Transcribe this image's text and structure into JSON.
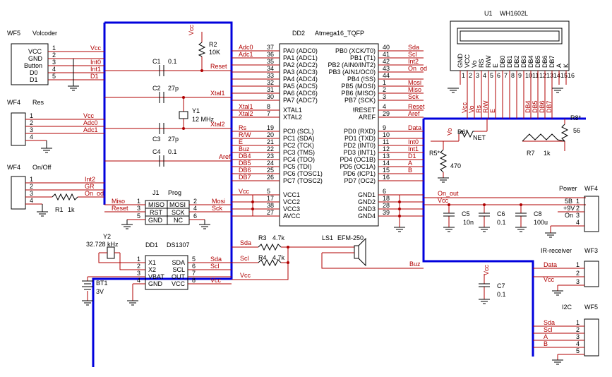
{
  "colors": {
    "wire": "#b00000",
    "bus": "#0000dd",
    "outline": "#000000"
  },
  "connectors": [
    {
      "id": "WF5",
      "name": "Volcoder",
      "pins": [
        "VCC",
        "GND",
        "Button",
        "D0",
        "D1"
      ],
      "nums": [
        "1",
        "2",
        "3",
        "4",
        "5"
      ],
      "nets": [
        "Vcc",
        "",
        "Int0",
        "Int1",
        "D1"
      ]
    },
    {
      "id": "WF4",
      "name": "Res",
      "nums": [
        "1",
        "2",
        "3",
        "4"
      ],
      "nets": [
        "Vcc",
        "Adc0",
        "Adc1",
        ""
      ]
    },
    {
      "id": "WF4",
      "name": "On/Off",
      "nums": [
        "1",
        "2",
        "3",
        "4"
      ],
      "nets": [
        "Int2",
        "GR",
        "On_od",
        ""
      ]
    }
  ],
  "mcu": {
    "ref": "DD2",
    "part": "Atmega16_TQFP",
    "left_nums": [
      "37",
      "36",
      "35",
      "34",
      "33",
      "32",
      "31",
      "30",
      "8",
      "7",
      "19",
      "20",
      "21",
      "22",
      "23",
      "24",
      "25",
      "26",
      "5",
      "17",
      "38",
      "27"
    ],
    "left_pins": [
      "PA0 (ADC0)",
      "PA1 (ADC1)",
      "PA2 (ADC2)",
      "PA3 (ADC3)",
      "PA4 (ADC4)",
      "PA5 (ADC5)",
      "PA6 (ADC6)",
      "PA7 (ADC7)",
      "XTAL1",
      "XTAL2",
      "PC0 (SCL)",
      "PC1 (SDA)",
      "PC2 (TCK)",
      "PC3 (TMS)",
      "PC4 (TDO)",
      "PC5 (TDI)",
      "PC6 (TOSC1)",
      "PC7 (TOSC2)",
      "VCC1",
      "VCC2",
      "VCC3",
      "AVCC"
    ],
    "left_nets": [
      "Adc0",
      "Adc1",
      "",
      "",
      "",
      "",
      "",
      "",
      "Xtal1",
      "Xtal2",
      "Rs",
      "R/W",
      "E",
      "Buz",
      "DB4",
      "DB5",
      "DB6",
      "DB7",
      "Vcc",
      "",
      "",
      ""
    ],
    "right_nums": [
      "40",
      "41",
      "42",
      "43",
      "44",
      "1",
      "2",
      "3",
      "4",
      "29",
      "9",
      "10",
      "11",
      "12",
      "13",
      "14",
      "15",
      "16",
      "6",
      "18",
      "28",
      "39"
    ],
    "right_pins": [
      "PB0 (XCK/T0)",
      "PB1 (T1)",
      "PB2 (AIN0/INT2)",
      "PB3 (AIN1/OC0)",
      "PB4 (!SS)",
      "PB5 (MOSI)",
      "PB6 (MISO)",
      "PB7 (SCK)",
      "!RESET",
      "AREF",
      "PD0 (RXD)",
      "PD1 (TXD)",
      "PD2 (INT0)",
      "PD3 (INT1)",
      "PD4 (OC1B)",
      "PD5 (OC1A)",
      "PD6 (ICP1)",
      "PD7 (OC2)",
      "GND1",
      "GND2",
      "GND3",
      "GND4"
    ],
    "right_nets": [
      "Sda",
      "Scl",
      "Int2",
      "On_od",
      "",
      "Mosi",
      "Miso",
      "Sck",
      "Reset",
      "Aref",
      "Data",
      "",
      "Int0",
      "Int1",
      "D1",
      "A",
      "B",
      "",
      "",
      "",
      "",
      ""
    ]
  },
  "parts": {
    "r2": {
      "ref": "R2",
      "value": "10K"
    },
    "c1": {
      "ref": "C1",
      "value": "0.1"
    },
    "c2": {
      "ref": "C2",
      "value": "27p"
    },
    "c3": {
      "ref": "C3",
      "value": "27p"
    },
    "c4": {
      "ref": "C4",
      "value": "0.1"
    },
    "y1": {
      "ref": "Y1",
      "value": "12 MHz"
    },
    "y2": {
      "ref": "Y2",
      "value": "32.728 kHz"
    },
    "r1": {
      "ref": "R1",
      "value": "1k"
    },
    "r3": {
      "ref": "R3",
      "value": "4.7k"
    },
    "r4": {
      "ref": "R4",
      "value": "4.7k"
    },
    "ls1": {
      "ref": "LS1",
      "value": "EFM-250"
    },
    "bt1": {
      "ref": "BT1",
      "value": "3V"
    },
    "c5": {
      "ref": "C5",
      "value": "10n"
    },
    "c6": {
      "ref": "C6",
      "value": "0.1"
    },
    "c7": {
      "ref": "C7",
      "value": "0.1"
    },
    "c8": {
      "ref": "C8",
      "value": "100u"
    },
    "r5": {
      "ref": "R5*",
      "value": "470"
    },
    "r6": {
      "ref": "R6*",
      "value": "NET"
    },
    "r7": {
      "ref": "R7",
      "value": "1k"
    },
    "r8": {
      "ref": "R8*",
      "value": "56"
    }
  },
  "prog": {
    "ref": "J1",
    "name": "Prog",
    "cells": [
      "MISO",
      "MOSI",
      "RST",
      "SCK",
      "GND",
      "NC"
    ],
    "left_nums": [
      "1",
      "3",
      "5"
    ],
    "right_nums": [
      "2",
      "4",
      "6"
    ],
    "left_nets": [
      "Miso",
      "Reset",
      ""
    ],
    "right_nets": [
      "Mosi",
      "Sck",
      ""
    ]
  },
  "rtc": {
    "ref": "DD1",
    "part": "DS1307",
    "left_pins": [
      "X1",
      "X2",
      "VBAT",
      "GND"
    ],
    "left_nums": [
      "1",
      "2",
      "3",
      "4"
    ],
    "right_pins": [
      "SDA",
      "SCL",
      "OUT",
      "VCC"
    ],
    "right_nums": [
      "5",
      "6",
      "7",
      "8"
    ],
    "right_nets": [
      "Sda",
      "Scl",
      "",
      "Vcc"
    ]
  },
  "lcd": {
    "ref": "U1",
    "part": "WH1602L",
    "pins": [
      "GND",
      "VCC",
      "Vo",
      "RS",
      "R/W",
      "E",
      "DB0",
      "DB1",
      "DB2",
      "DB3",
      "DB4",
      "DB5",
      "DB6",
      "DB7",
      "A",
      "K"
    ],
    "nums": [
      "1",
      "2",
      "3",
      "4",
      "5",
      "6",
      "7",
      "8",
      "9",
      "10",
      "11",
      "12",
      "13",
      "14",
      "15",
      "16"
    ],
    "nets": [
      "",
      "Vcc",
      "Vo",
      "Rs",
      "R/W",
      "E",
      "",
      "",
      "",
      "",
      "DB4",
      "DB5",
      "DB6",
      "DB7",
      "",
      ""
    ]
  },
  "right_connectors": {
    "power": {
      "id": "WF4",
      "name": "Power",
      "pins": [
        "5B",
        "+9V",
        "On"
      ],
      "nums": [
        "1",
        "2",
        "3",
        "4"
      ],
      "nets": [
        "On_out",
        "Vcc"
      ]
    },
    "ir": {
      "id": "WF3",
      "name": "IR-receiver",
      "nums": [
        "1",
        "2",
        "3"
      ],
      "nets": [
        "Data",
        "Vcc"
      ]
    },
    "i2c": {
      "id": "WF5",
      "name": "I2C",
      "nums": [
        "1",
        "2",
        "3",
        "4",
        "5"
      ],
      "nets": [
        "Sda",
        "Scl",
        "A",
        "B"
      ]
    }
  },
  "nets": {
    "vcc": "Vcc",
    "reset": "Reset",
    "xtal1": "Xtal1",
    "xtal2": "Xtal2",
    "aref": "Aref",
    "sda": "Sda",
    "scl": "Scl",
    "buz": "Buz",
    "on_out": "On_out",
    "vo": "Vo",
    "int2": "Int2",
    "on_od": "On_od"
  }
}
